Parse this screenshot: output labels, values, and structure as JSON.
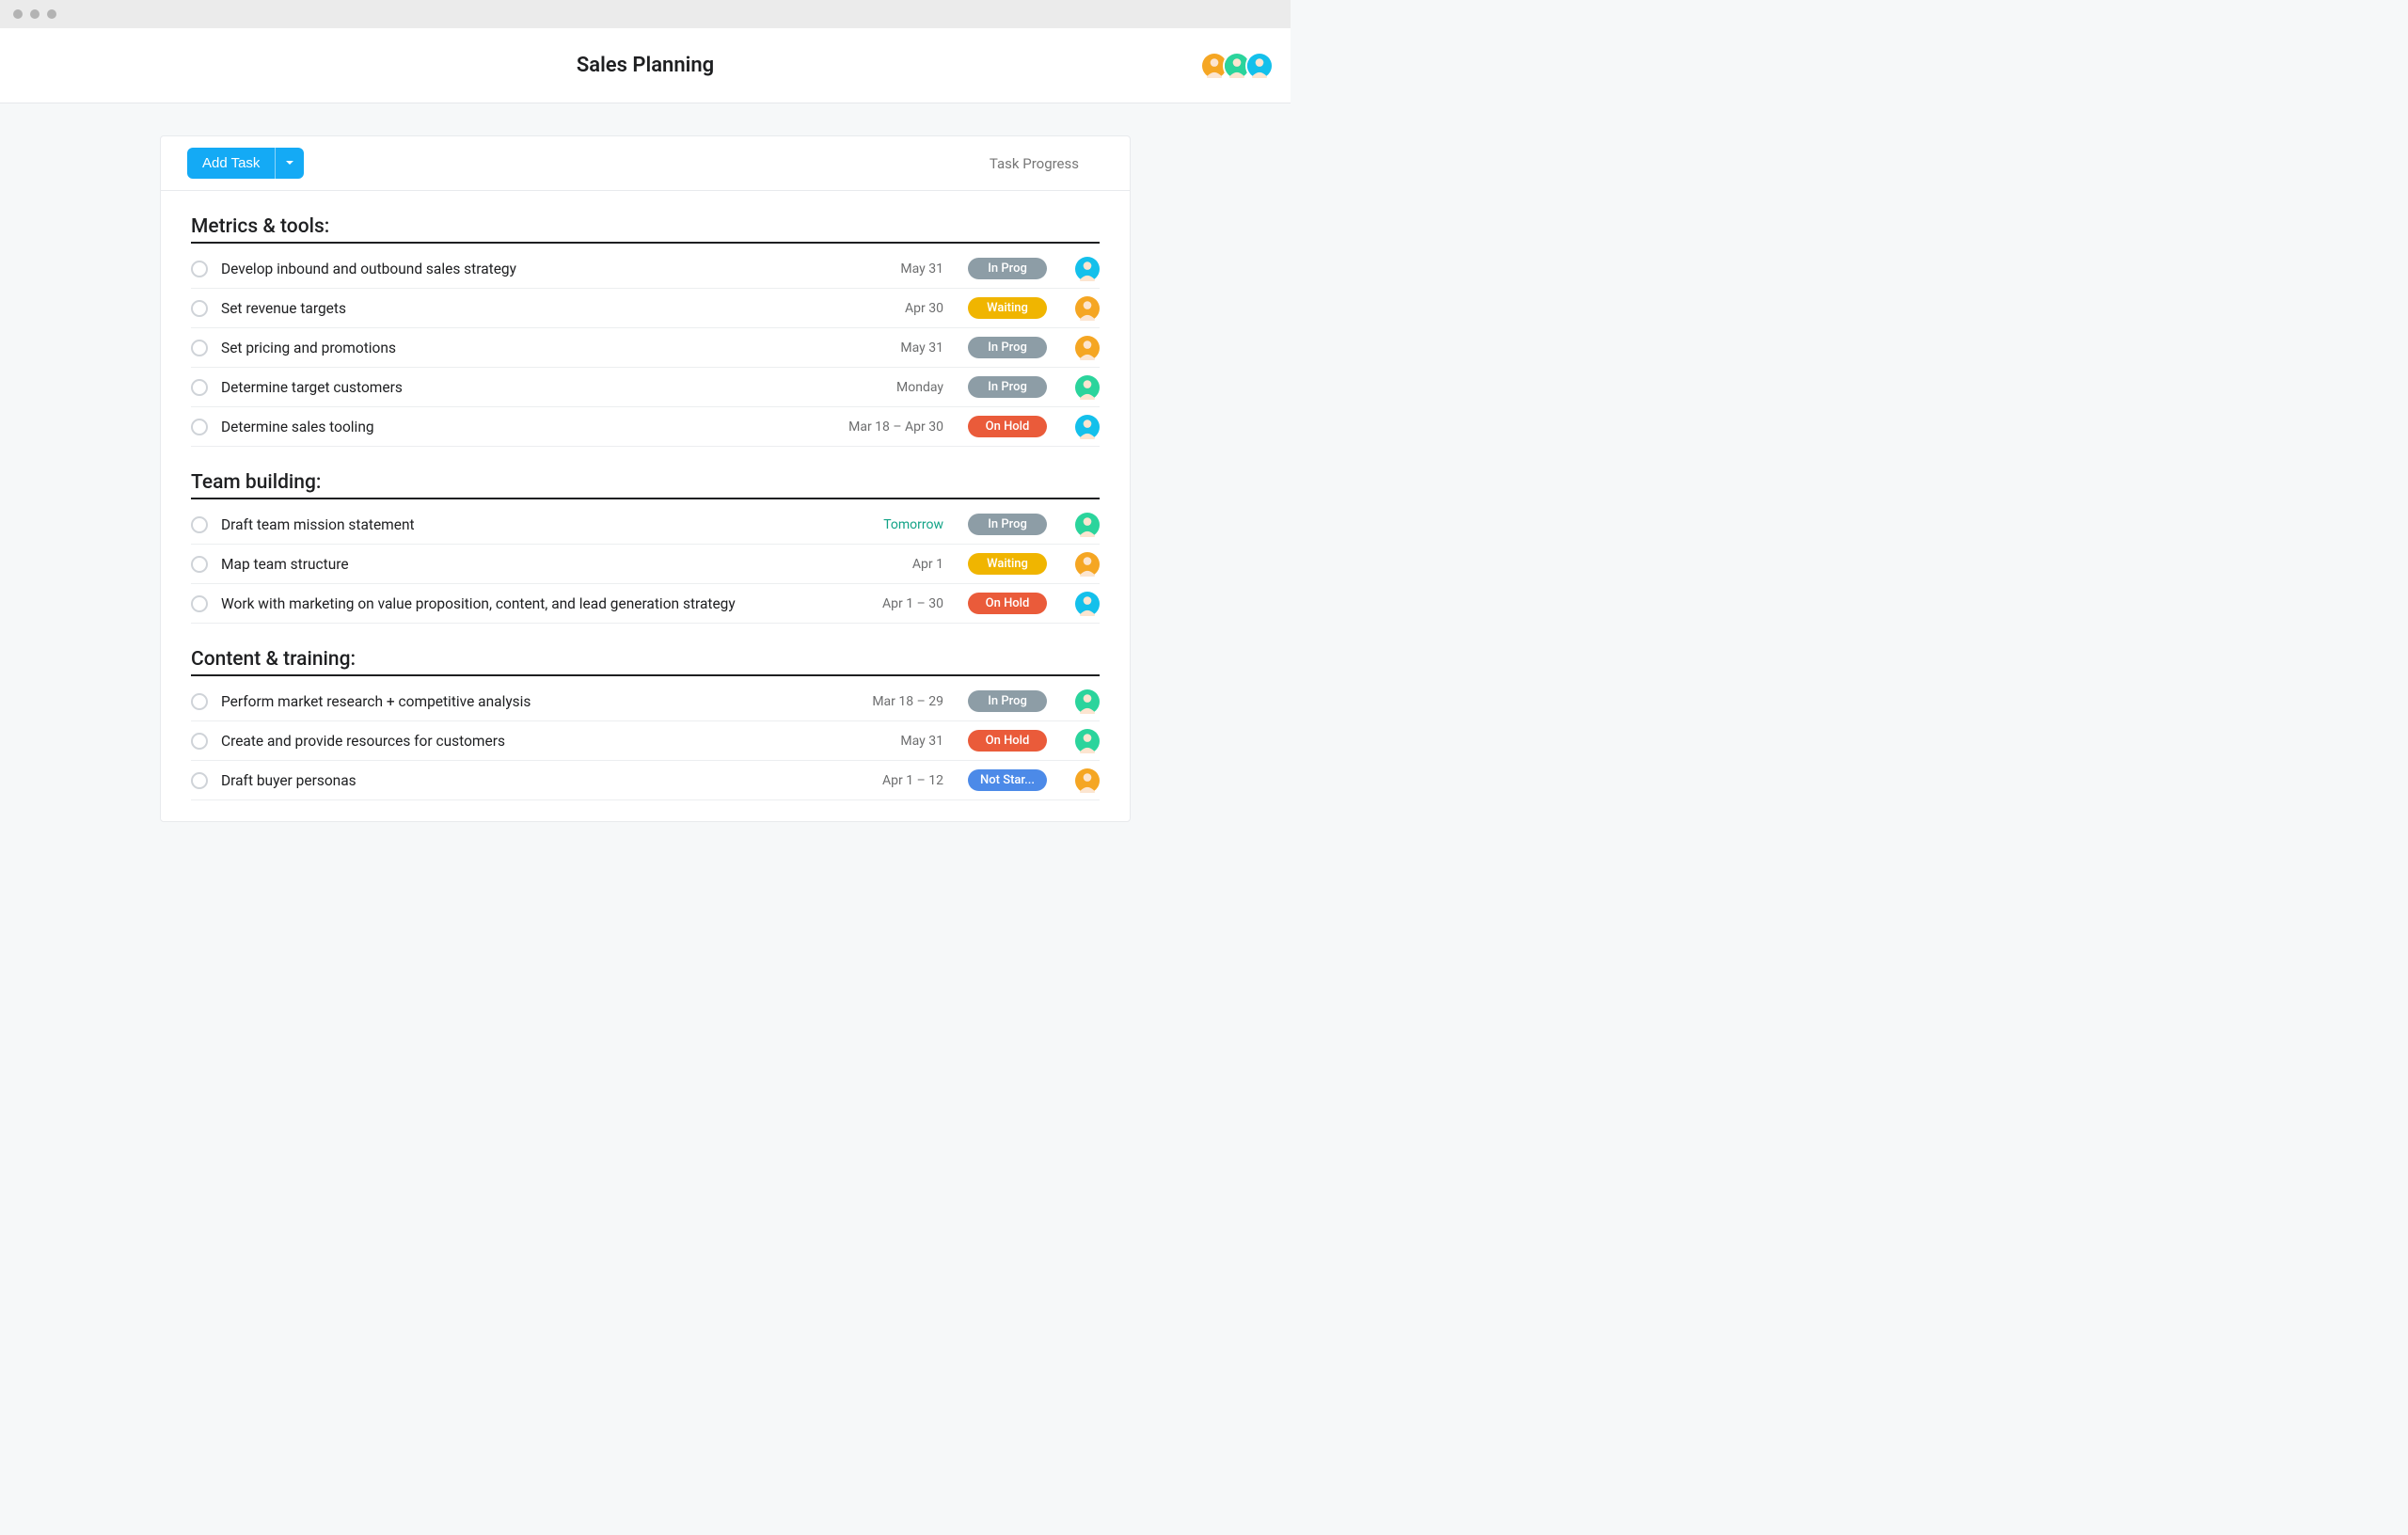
{
  "header": {
    "title": "Sales Planning",
    "avatars": [
      {
        "bg": "#f5a623"
      },
      {
        "bg": "#2bd49c"
      },
      {
        "bg": "#14c0eb"
      }
    ]
  },
  "toolbar": {
    "add_task_label": "Add Task",
    "task_progress_label": "Task Progress"
  },
  "status_styles": {
    "In Prog": "status-inprog",
    "Waiting": "status-waiting",
    "On Hold": "status-onhold",
    "Not Star...": "status-notstar"
  },
  "avatar_palette": {
    "blue": "#14c0eb",
    "yellow": "#f5a623",
    "green": "#2bd49c"
  },
  "sections": [
    {
      "title": "Metrics & tools:",
      "tasks": [
        {
          "name": "Develop inbound and outbound sales strategy",
          "date": "May 31",
          "status": "In Prog",
          "avatar": "blue"
        },
        {
          "name": "Set revenue targets",
          "date": "Apr 30",
          "status": "Waiting",
          "avatar": "yellow"
        },
        {
          "name": "Set pricing and promotions",
          "date": "May 31",
          "status": "In Prog",
          "avatar": "yellow"
        },
        {
          "name": "Determine target customers",
          "date": "Monday",
          "status": "In Prog",
          "avatar": "green"
        },
        {
          "name": "Determine sales tooling",
          "date": "Mar 18 – Apr 30",
          "status": "On Hold",
          "avatar": "blue"
        }
      ]
    },
    {
      "title": "Team building:",
      "tasks": [
        {
          "name": "Draft team mission statement",
          "date": "Tomorrow",
          "date_soon": true,
          "status": "In Prog",
          "avatar": "green"
        },
        {
          "name": "Map team structure",
          "date": "Apr 1",
          "status": "Waiting",
          "avatar": "yellow"
        },
        {
          "name": "Work with marketing on value proposition, content, and lead generation strategy",
          "date": "Apr 1 – 30",
          "status": "On Hold",
          "avatar": "blue"
        }
      ]
    },
    {
      "title": "Content & training:",
      "tasks": [
        {
          "name": "Perform market research + competitive analysis",
          "date": "Mar 18 – 29",
          "status": "In Prog",
          "avatar": "green"
        },
        {
          "name": "Create and provide resources for customers",
          "date": "May 31",
          "status": "On Hold",
          "avatar": "green"
        },
        {
          "name": "Draft buyer personas",
          "date": "Apr 1 – 12",
          "status": "Not Star...",
          "avatar": "yellow"
        }
      ]
    }
  ]
}
